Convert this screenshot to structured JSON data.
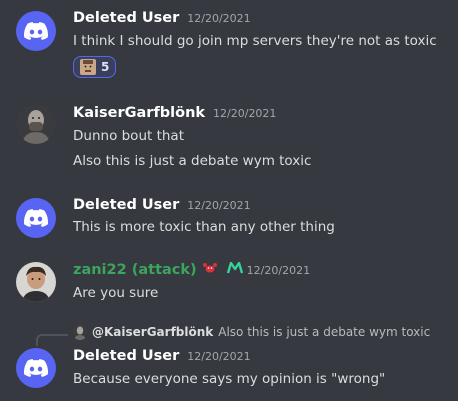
{
  "messages": [
    {
      "username": "Deleted User",
      "timestamp": "12/20/2021",
      "lines": [
        "I think I should go join mp servers they're not as toxic"
      ],
      "reaction": {
        "icon": "face-emoji",
        "count": "5"
      }
    },
    {
      "username": "KaiserGarfblönk",
      "timestamp": "12/20/2021",
      "lines": [
        "Dunno bout that",
        "Also this is just a debate wym toxic"
      ]
    },
    {
      "username": "Deleted User",
      "timestamp": "12/20/2021",
      "lines": [
        "This is more toxic than any other thing"
      ]
    },
    {
      "username": "zani22 (attack)",
      "timestamp": "12/20/2021",
      "username_color": "#3ba55d",
      "badges": [
        "red-crab-icon",
        "green-m-icon"
      ],
      "lines": [
        "Are you sure"
      ]
    },
    {
      "username": "Deleted User",
      "timestamp": "12/20/2021",
      "lines": [
        "Because everyone says my opinion is \"wrong\""
      ],
      "reply": {
        "username": "@KaiserGarfblönk",
        "text": "Also this is just a debate wym toxic"
      }
    }
  ],
  "colors": {
    "background": "#36393f",
    "blurple": "#5865f2",
    "text": "#dcddde",
    "muted": "#a3a6aa"
  }
}
